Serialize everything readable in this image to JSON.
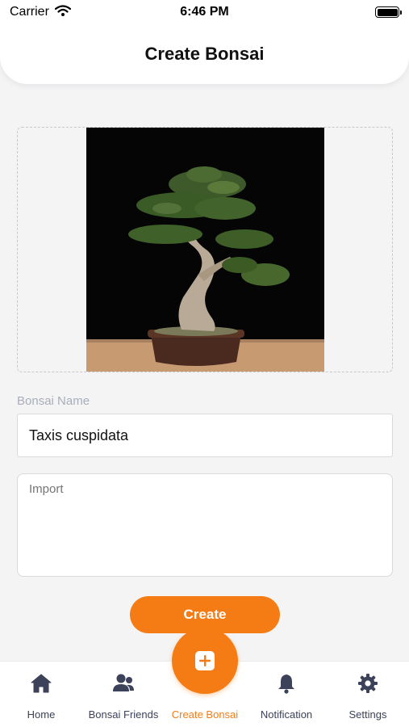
{
  "status_bar": {
    "carrier": "Carrier",
    "time": "6:46 PM"
  },
  "header": {
    "title": "Create Bonsai"
  },
  "form": {
    "image_alt": "Bonsai tree photo",
    "name_label": "Bonsai Name",
    "name_value": "Taxis cuspidata",
    "description_placeholder": "Import",
    "create_label": "Create"
  },
  "bottom_nav": {
    "items": [
      {
        "label": "Home",
        "icon": "home-icon"
      },
      {
        "label": "Bonsai Friends",
        "icon": "users-icon"
      },
      {
        "label": "Create Bonsai",
        "icon": "plus-square-icon",
        "active": true
      },
      {
        "label": "Notification",
        "icon": "bell-icon"
      },
      {
        "label": "Settings",
        "icon": "gear-icon"
      }
    ]
  },
  "colors": {
    "accent": "#f57c14",
    "nav_icon": "#3b4259",
    "label_muted": "#a9adbb",
    "background": "#f4f4f5"
  }
}
